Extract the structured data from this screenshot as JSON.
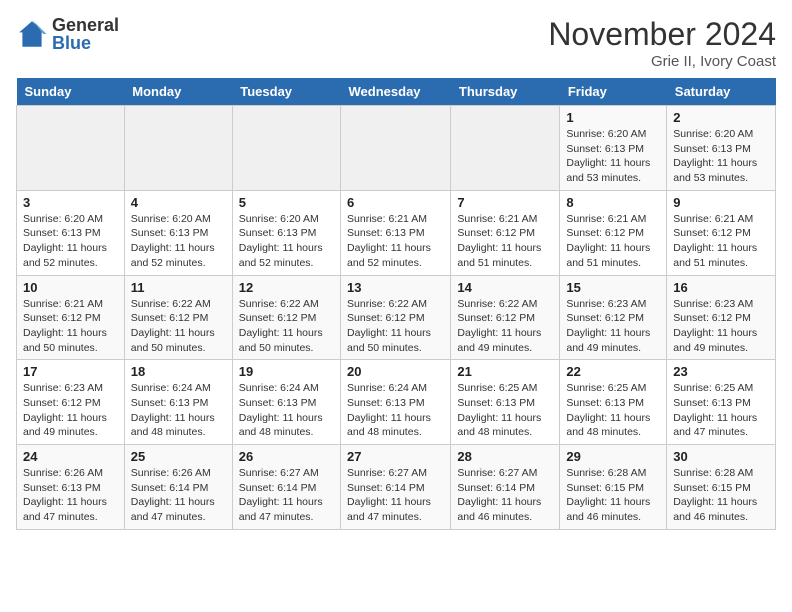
{
  "logo": {
    "general": "General",
    "blue": "Blue"
  },
  "title": "November 2024",
  "subtitle": "Grie II, Ivory Coast",
  "days_header": [
    "Sunday",
    "Monday",
    "Tuesday",
    "Wednesday",
    "Thursday",
    "Friday",
    "Saturday"
  ],
  "weeks": [
    [
      {
        "day": "",
        "empty": true
      },
      {
        "day": "",
        "empty": true
      },
      {
        "day": "",
        "empty": true
      },
      {
        "day": "",
        "empty": true
      },
      {
        "day": "",
        "empty": true
      },
      {
        "day": "1",
        "sunrise": "6:20 AM",
        "sunset": "6:13 PM",
        "daylight": "11 hours and 53 minutes."
      },
      {
        "day": "2",
        "sunrise": "6:20 AM",
        "sunset": "6:13 PM",
        "daylight": "11 hours and 53 minutes."
      }
    ],
    [
      {
        "day": "3",
        "sunrise": "6:20 AM",
        "sunset": "6:13 PM",
        "daylight": "11 hours and 52 minutes."
      },
      {
        "day": "4",
        "sunrise": "6:20 AM",
        "sunset": "6:13 PM",
        "daylight": "11 hours and 52 minutes."
      },
      {
        "day": "5",
        "sunrise": "6:20 AM",
        "sunset": "6:13 PM",
        "daylight": "11 hours and 52 minutes."
      },
      {
        "day": "6",
        "sunrise": "6:21 AM",
        "sunset": "6:13 PM",
        "daylight": "11 hours and 52 minutes."
      },
      {
        "day": "7",
        "sunrise": "6:21 AM",
        "sunset": "6:12 PM",
        "daylight": "11 hours and 51 minutes."
      },
      {
        "day": "8",
        "sunrise": "6:21 AM",
        "sunset": "6:12 PM",
        "daylight": "11 hours and 51 minutes."
      },
      {
        "day": "9",
        "sunrise": "6:21 AM",
        "sunset": "6:12 PM",
        "daylight": "11 hours and 51 minutes."
      }
    ],
    [
      {
        "day": "10",
        "sunrise": "6:21 AM",
        "sunset": "6:12 PM",
        "daylight": "11 hours and 50 minutes."
      },
      {
        "day": "11",
        "sunrise": "6:22 AM",
        "sunset": "6:12 PM",
        "daylight": "11 hours and 50 minutes."
      },
      {
        "day": "12",
        "sunrise": "6:22 AM",
        "sunset": "6:12 PM",
        "daylight": "11 hours and 50 minutes."
      },
      {
        "day": "13",
        "sunrise": "6:22 AM",
        "sunset": "6:12 PM",
        "daylight": "11 hours and 50 minutes."
      },
      {
        "day": "14",
        "sunrise": "6:22 AM",
        "sunset": "6:12 PM",
        "daylight": "11 hours and 49 minutes."
      },
      {
        "day": "15",
        "sunrise": "6:23 AM",
        "sunset": "6:12 PM",
        "daylight": "11 hours and 49 minutes."
      },
      {
        "day": "16",
        "sunrise": "6:23 AM",
        "sunset": "6:12 PM",
        "daylight": "11 hours and 49 minutes."
      }
    ],
    [
      {
        "day": "17",
        "sunrise": "6:23 AM",
        "sunset": "6:12 PM",
        "daylight": "11 hours and 49 minutes."
      },
      {
        "day": "18",
        "sunrise": "6:24 AM",
        "sunset": "6:13 PM",
        "daylight": "11 hours and 48 minutes."
      },
      {
        "day": "19",
        "sunrise": "6:24 AM",
        "sunset": "6:13 PM",
        "daylight": "11 hours and 48 minutes."
      },
      {
        "day": "20",
        "sunrise": "6:24 AM",
        "sunset": "6:13 PM",
        "daylight": "11 hours and 48 minutes."
      },
      {
        "day": "21",
        "sunrise": "6:25 AM",
        "sunset": "6:13 PM",
        "daylight": "11 hours and 48 minutes."
      },
      {
        "day": "22",
        "sunrise": "6:25 AM",
        "sunset": "6:13 PM",
        "daylight": "11 hours and 48 minutes."
      },
      {
        "day": "23",
        "sunrise": "6:25 AM",
        "sunset": "6:13 PM",
        "daylight": "11 hours and 47 minutes."
      }
    ],
    [
      {
        "day": "24",
        "sunrise": "6:26 AM",
        "sunset": "6:13 PM",
        "daylight": "11 hours and 47 minutes."
      },
      {
        "day": "25",
        "sunrise": "6:26 AM",
        "sunset": "6:14 PM",
        "daylight": "11 hours and 47 minutes."
      },
      {
        "day": "26",
        "sunrise": "6:27 AM",
        "sunset": "6:14 PM",
        "daylight": "11 hours and 47 minutes."
      },
      {
        "day": "27",
        "sunrise": "6:27 AM",
        "sunset": "6:14 PM",
        "daylight": "11 hours and 47 minutes."
      },
      {
        "day": "28",
        "sunrise": "6:27 AM",
        "sunset": "6:14 PM",
        "daylight": "11 hours and 46 minutes."
      },
      {
        "day": "29",
        "sunrise": "6:28 AM",
        "sunset": "6:15 PM",
        "daylight": "11 hours and 46 minutes."
      },
      {
        "day": "30",
        "sunrise": "6:28 AM",
        "sunset": "6:15 PM",
        "daylight": "11 hours and 46 minutes."
      }
    ]
  ]
}
